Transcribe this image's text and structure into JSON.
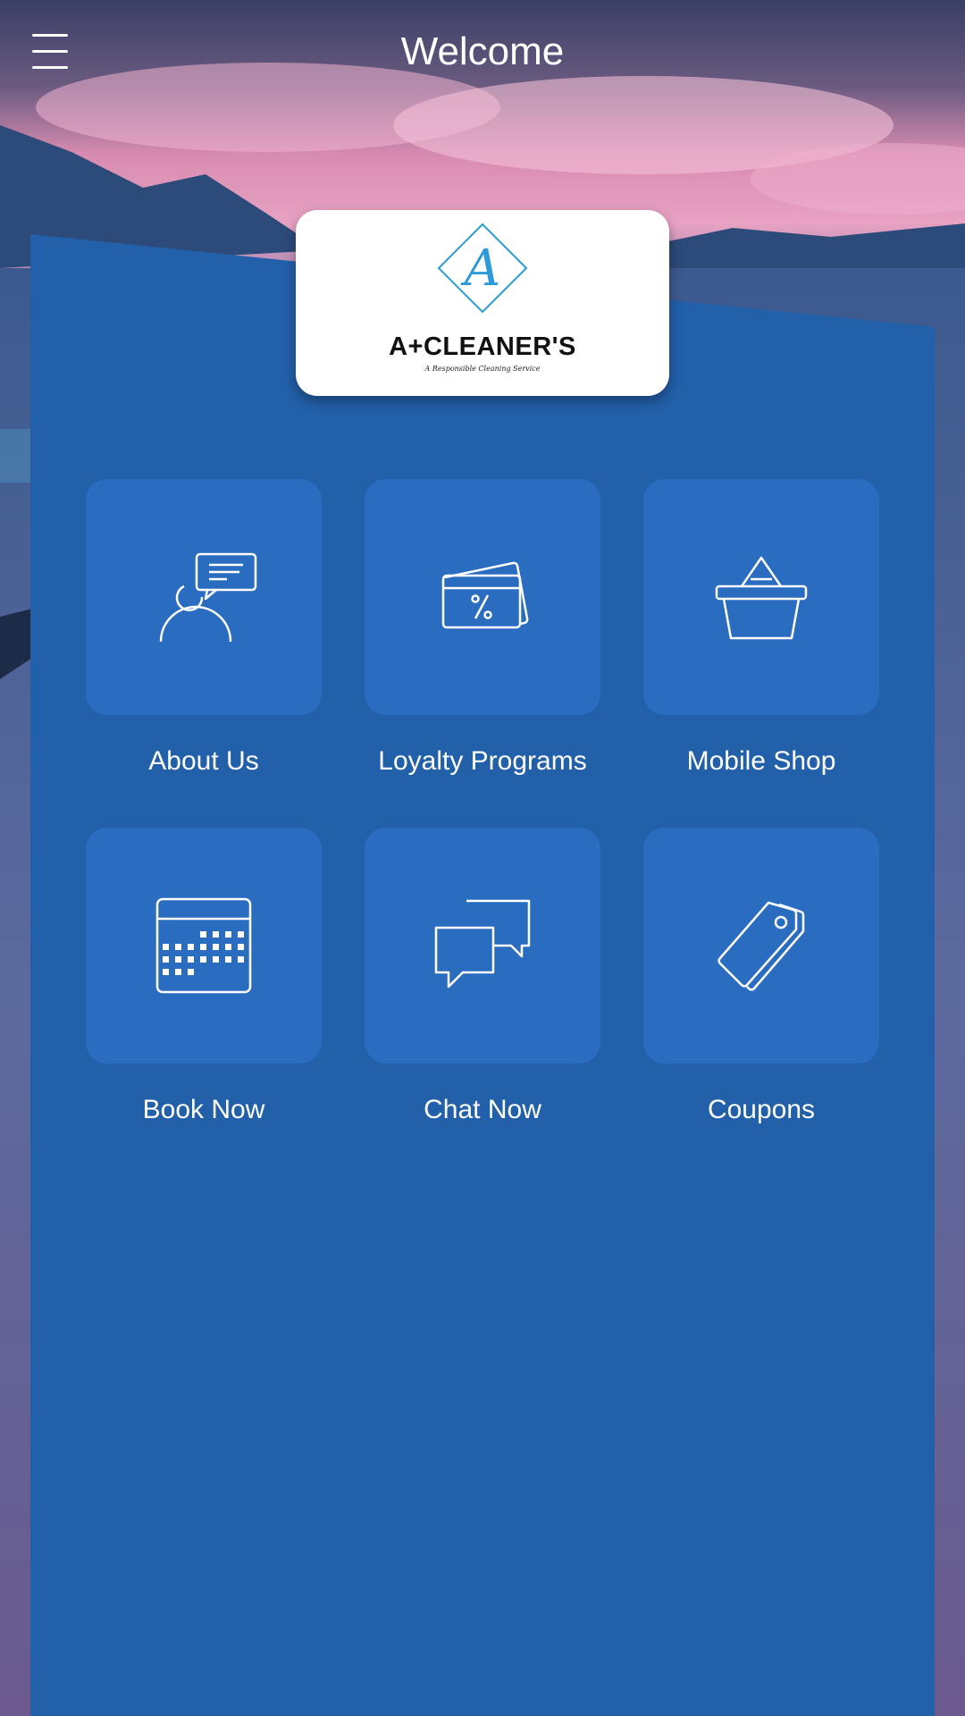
{
  "header": {
    "title": "Welcome",
    "menu_icon": "hamburger-menu-icon"
  },
  "logo": {
    "mark_letter": "A",
    "name": "A+CLEANER'S",
    "tagline": "A Responsible Cleaning Service"
  },
  "tiles": [
    {
      "label": "About Us",
      "icon": "person-chat-icon"
    },
    {
      "label": "Loyalty Programs",
      "icon": "discount-card-icon"
    },
    {
      "label": "Mobile Shop",
      "icon": "shopping-basket-icon"
    },
    {
      "label": "Book Now",
      "icon": "calendar-icon"
    },
    {
      "label": "Chat Now",
      "icon": "chat-bubbles-icon"
    },
    {
      "label": "Coupons",
      "icon": "price-tags-icon"
    }
  ],
  "colors": {
    "panel": "#2260aa",
    "tile": "#2a6dc0",
    "logo_accent": "#2a9bd8",
    "text": "#ffffff"
  }
}
